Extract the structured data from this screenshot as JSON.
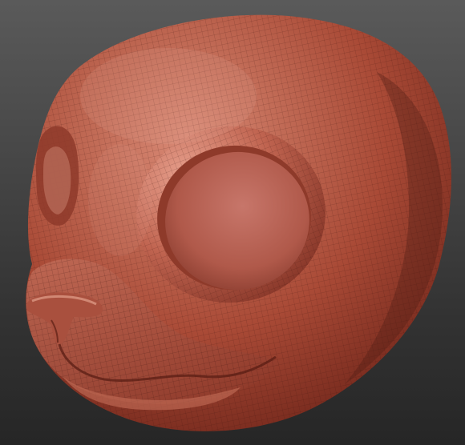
{
  "viewport": {
    "background_top": "#5a5a5a",
    "background_bottom": "#262626"
  },
  "model": {
    "subject": "sculpted-head",
    "material_color": "#b2503d",
    "highlight_color": "#d98a76",
    "shadow_color": "#4e1c14",
    "wireframe_visible": true
  }
}
